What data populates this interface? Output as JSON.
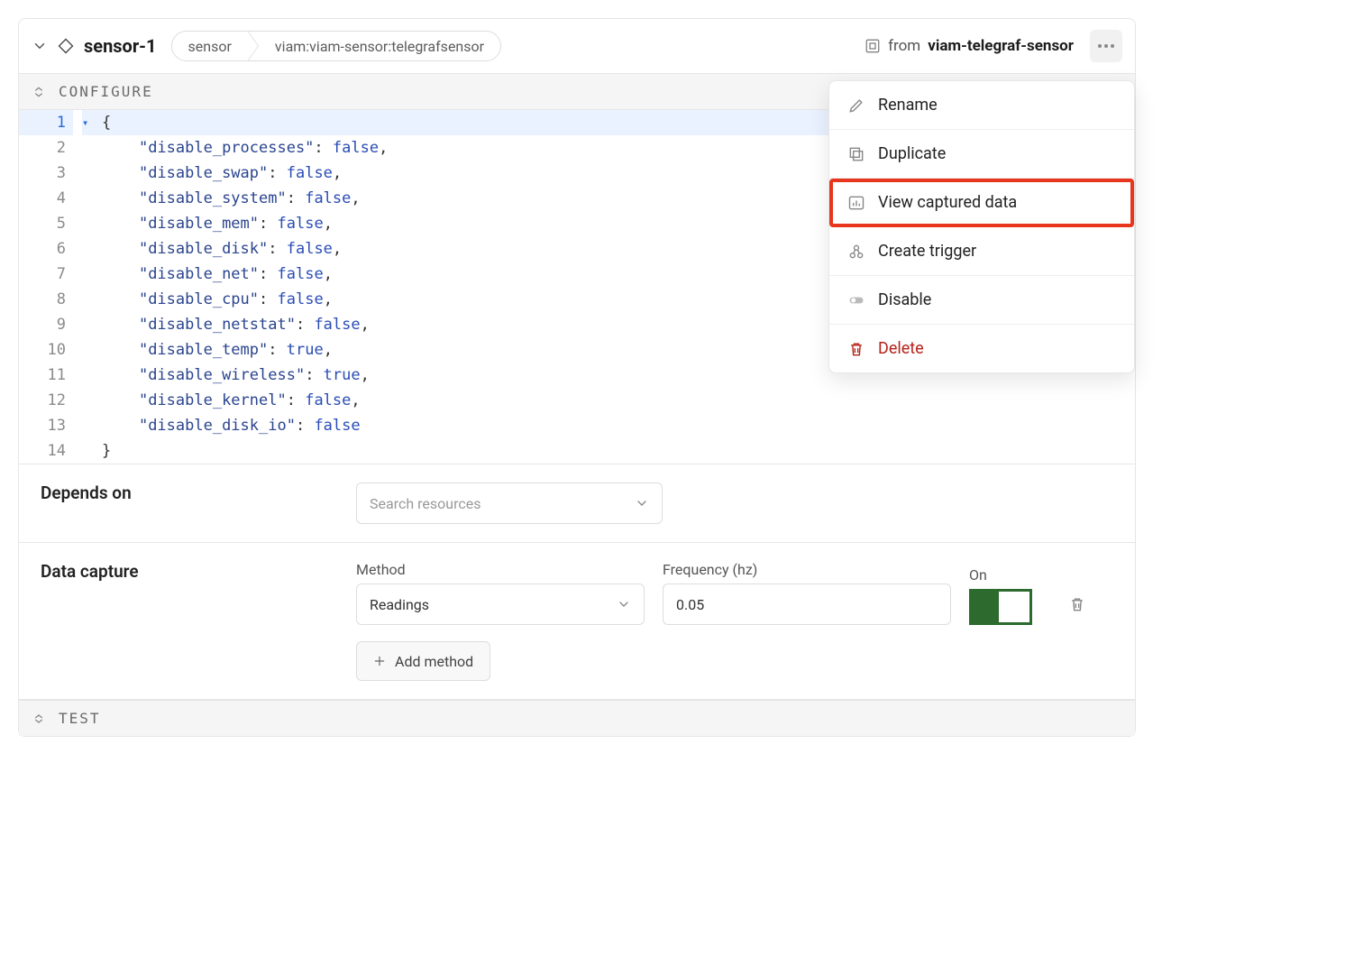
{
  "header": {
    "component_name": "sensor-1",
    "breadcrumb": {
      "type": "sensor",
      "model": "viam:viam-sensor:telegrafsensor"
    },
    "from_label": "from",
    "module_name": "viam-telegraf-sensor"
  },
  "sections": {
    "configure_label": "CONFIGURE",
    "test_label": "TEST"
  },
  "code_lines": [
    {
      "n": 1,
      "text": "{",
      "fold": "▾"
    },
    {
      "n": 2,
      "key": "disable_processes",
      "val": "false"
    },
    {
      "n": 3,
      "key": "disable_swap",
      "val": "false"
    },
    {
      "n": 4,
      "key": "disable_system",
      "val": "false"
    },
    {
      "n": 5,
      "key": "disable_mem",
      "val": "false"
    },
    {
      "n": 6,
      "key": "disable_disk",
      "val": "false"
    },
    {
      "n": 7,
      "key": "disable_net",
      "val": "false"
    },
    {
      "n": 8,
      "key": "disable_cpu",
      "val": "false"
    },
    {
      "n": 9,
      "key": "disable_netstat",
      "val": "false"
    },
    {
      "n": 10,
      "key": "disable_temp",
      "val": "true"
    },
    {
      "n": 11,
      "key": "disable_wireless",
      "val": "true"
    },
    {
      "n": 12,
      "key": "disable_kernel",
      "val": "false"
    },
    {
      "n": 13,
      "key": "disable_disk_io",
      "val": "false",
      "last": true
    },
    {
      "n": 14,
      "text": "}"
    }
  ],
  "depends_on": {
    "label": "Depends on",
    "search_placeholder": "Search resources"
  },
  "data_capture": {
    "label": "Data capture",
    "method_label": "Method",
    "method_value": "Readings",
    "freq_label": "Frequency (hz)",
    "freq_value": "0.05",
    "on_label": "On",
    "add_method_label": "Add method"
  },
  "menu": {
    "rename": "Rename",
    "duplicate": "Duplicate",
    "view_data": "View captured data",
    "create_trigger": "Create trigger",
    "disable": "Disable",
    "delete": "Delete"
  }
}
